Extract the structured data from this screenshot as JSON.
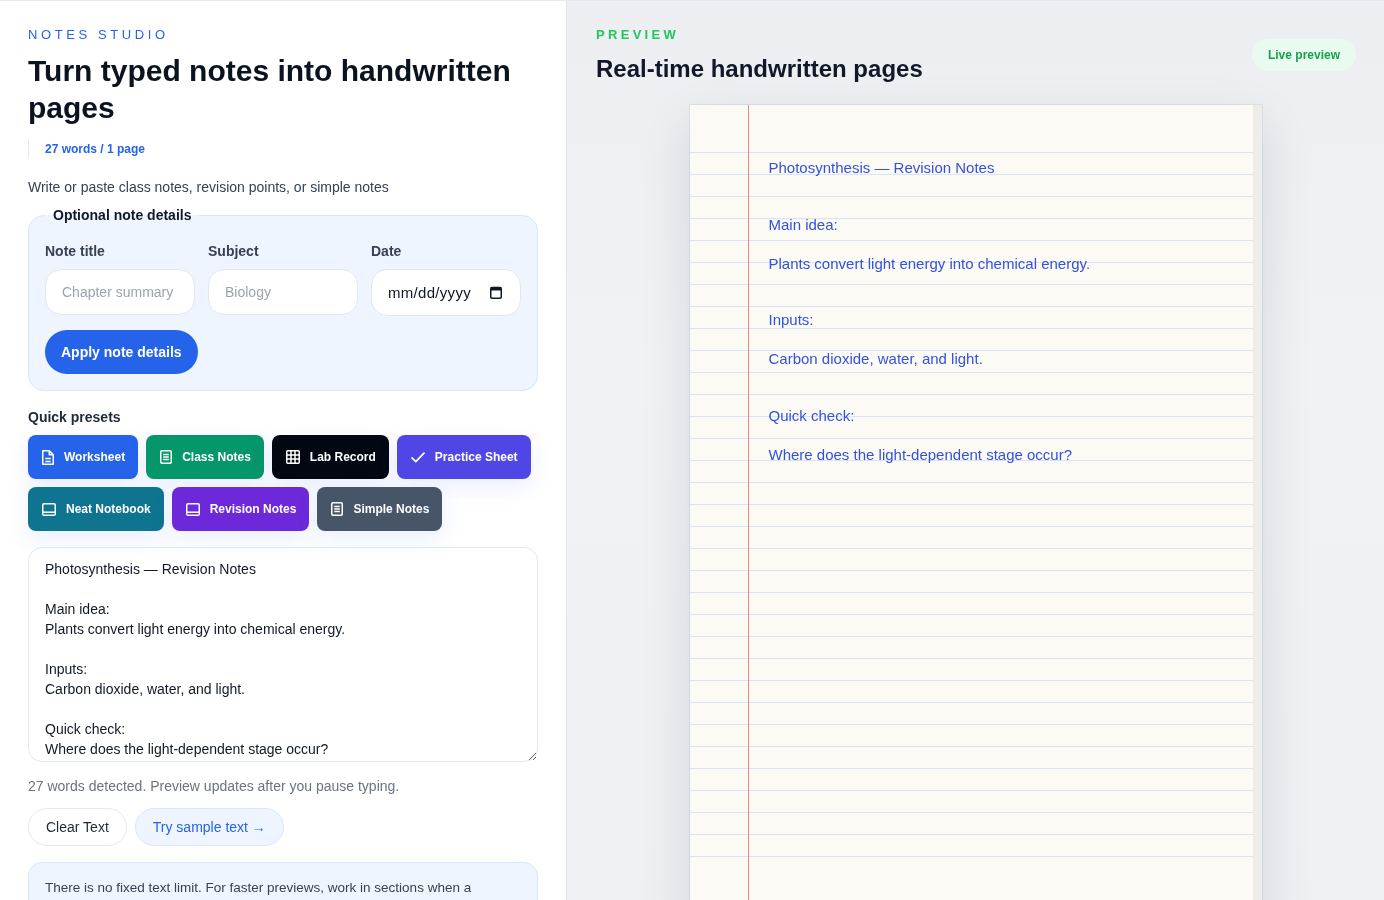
{
  "editor": {
    "brand": "NOTES STUDIO",
    "title": "Turn typed notes into handwritten pages",
    "stats": "27 words / 1 page",
    "prompt": "Write or paste class notes, revision points, or simple notes",
    "details": {
      "legend": "Optional note details",
      "fields": [
        {
          "label": "Note title",
          "placeholder": "Chapter summary",
          "kind": "text"
        },
        {
          "label": "Subject",
          "placeholder": "Biology",
          "kind": "text"
        },
        {
          "label": "Date",
          "placeholder": "mm/dd/yyyy",
          "kind": "date"
        }
      ],
      "apply_button": "Apply note details"
    },
    "presets": {
      "label": "Quick presets",
      "items": [
        {
          "label": "Worksheet",
          "kind": "file",
          "color": "#2563eb"
        },
        {
          "label": "Class Notes",
          "kind": "lines",
          "color": "#059669"
        },
        {
          "label": "Lab Record",
          "kind": "grid",
          "color": "#030712"
        },
        {
          "label": "Practice Sheet",
          "kind": "check",
          "color": "#4f46e5"
        },
        {
          "label": "Neat Notebook",
          "kind": "book",
          "color": "#0e7490"
        },
        {
          "label": "Revision Notes",
          "kind": "book",
          "color": "#6d28d9"
        },
        {
          "label": "Simple Notes",
          "kind": "lines",
          "color": "#475569"
        }
      ]
    },
    "notes_field": {
      "value": "Photosynthesis — Revision Notes\n\nMain idea:\nPlants convert light energy into chemical energy.\n\nInputs:\nCarbon dioxide, water, and light.\n\nQuick check:\nWhere does the light-dependent stage occur?"
    },
    "hint": "27 words detected. Preview updates after you pause typing.",
    "buttons": [
      {
        "label": "Clear Text",
        "kind": "clear"
      },
      {
        "label": "Try sample text →",
        "kind": "sample"
      }
    ],
    "info": "There is no fixed text limit. For faster previews, work in sections when a"
  },
  "preview": {
    "eyebrow": "PREVIEW",
    "title": "Real-time handwritten pages",
    "badge": "Live preview",
    "page": {
      "blocks": [
        {
          "lines": [
            "Photosynthesis — Revision Notes"
          ]
        },
        {
          "lines": [
            "Main idea:",
            "Plants convert light energy into chemical energy."
          ]
        },
        {
          "lines": [
            "Inputs:",
            "Carbon dioxide, water, and light."
          ]
        },
        {
          "lines": [
            "Quick check:",
            "Where does the light-dependent stage occur?"
          ]
        }
      ]
    }
  }
}
